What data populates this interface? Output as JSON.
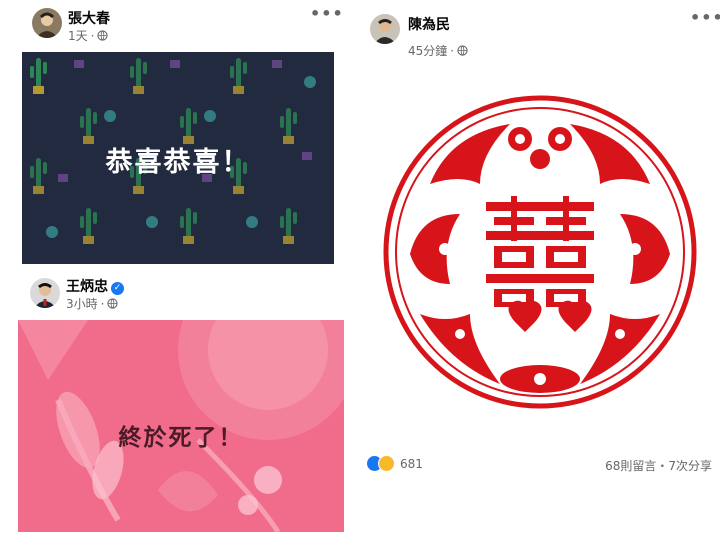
{
  "posts": [
    {
      "author": "張大春",
      "time": "1天",
      "privacy_icon": "globe-icon",
      "card_text": "恭喜恭喜！",
      "card_color": "#222a3f"
    },
    {
      "author": "王炳忠",
      "verified": true,
      "time": "3小時",
      "privacy_icon": "globe-icon",
      "card_text": "終於死了！",
      "card_color": "#f16c8a"
    },
    {
      "author": "陳為民",
      "time": "45分鐘",
      "privacy_icon": "globe-icon",
      "image": "double-happiness-papercut",
      "reaction_count": "681",
      "reactions": [
        "like-icon",
        "haha-icon"
      ],
      "stats": "68則留言・7次分享"
    }
  ],
  "ui": {
    "more_label": "•••",
    "dot_sep": "·"
  },
  "colors": {
    "papercut_red": "#d7141a",
    "meta_gray": "#65676b",
    "facebook_blue": "#1877f2"
  }
}
